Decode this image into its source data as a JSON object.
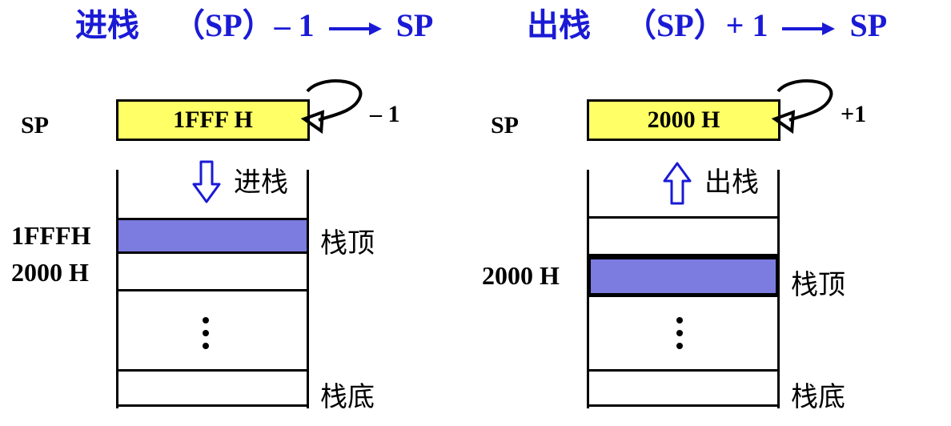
{
  "titles": {
    "push": {
      "word": "进栈",
      "formula": "（SP）– 1",
      "target": "SP"
    },
    "pop": {
      "word": "出栈",
      "formula": "（SP）+ 1",
      "target": "SP"
    }
  },
  "left": {
    "sp_label": "SP",
    "register_value": "1FFF H",
    "delta": "– 1",
    "arrow_label": "进栈",
    "addresses": [
      "1FFFH",
      "2000 H"
    ],
    "top_label": "栈顶",
    "bottom_label": "栈底"
  },
  "right": {
    "sp_label": "SP",
    "register_value": "2000 H",
    "delta": "+1",
    "arrow_label": "出栈",
    "addresses": [
      "2000 H"
    ],
    "top_label": "栈顶",
    "bottom_label": "栈底"
  },
  "colors": {
    "title": "#1a1ad6",
    "register_fill": "#ffff66",
    "stack_top_fill": "#7b7be0",
    "arrow_blue": "#1a1ad6"
  }
}
